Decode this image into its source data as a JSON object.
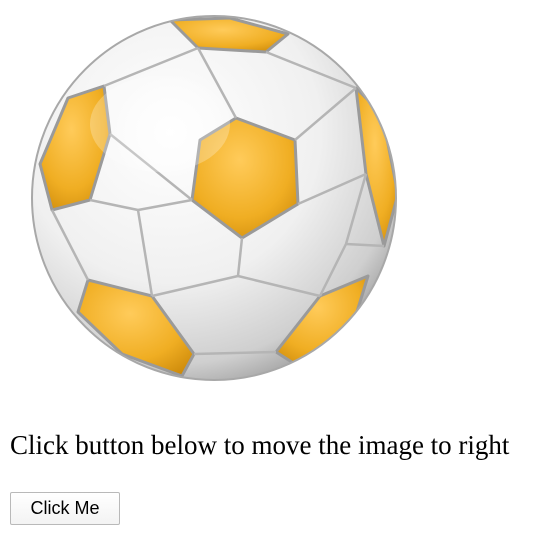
{
  "image": {
    "alt": "soccer-ball",
    "colors": {
      "patch": "#f0ae23",
      "patch_dark": "#d48f10",
      "panel": "#f4f4f4",
      "seam": "#8a8a8a"
    }
  },
  "instruction": {
    "text": "Click button below to move the image to right"
  },
  "button": {
    "label": "Click Me"
  }
}
